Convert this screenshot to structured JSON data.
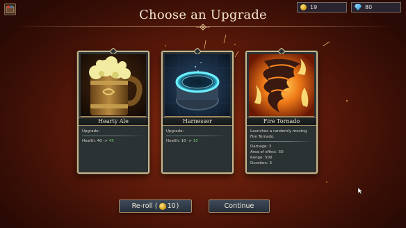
{
  "header": {
    "title": "Choose an Upgrade",
    "gold": "19",
    "gems": "80"
  },
  "cards": [
    {
      "name": "Hearty Ale",
      "description": "",
      "upgrade_label": "Upgrade:",
      "stats": [
        {
          "label": "Health:",
          "from": "40",
          "arrow": "->",
          "to": "45"
        }
      ],
      "art_icon": "ale-mug-icon"
    },
    {
      "name": "Harnesser",
      "description": "",
      "upgrade_label": "Upgrade:",
      "stats": [
        {
          "label": "Health:",
          "from": "10",
          "arrow": "->",
          "to": "15"
        }
      ],
      "art_icon": "portal-icon"
    },
    {
      "name": "Fire Tornado",
      "description": "Launches a randomly moving Fire Tornado.",
      "stats": [
        {
          "label": "Damage:",
          "value": "3"
        },
        {
          "label": "Area of effect:",
          "value": "50"
        },
        {
          "label": "Range:",
          "value": "500"
        },
        {
          "label": "Duration:",
          "value": "3"
        }
      ],
      "art_icon": "fire-tornado-icon"
    }
  ],
  "buttons": {
    "reroll_prefix": "Re-roll (",
    "reroll_cost": "10",
    "reroll_suffix": ")",
    "continue": "Continue"
  },
  "colors": {
    "accent_green": "#6fd36a",
    "card_border": "#c9b58c",
    "background": "#5e1a0a"
  }
}
